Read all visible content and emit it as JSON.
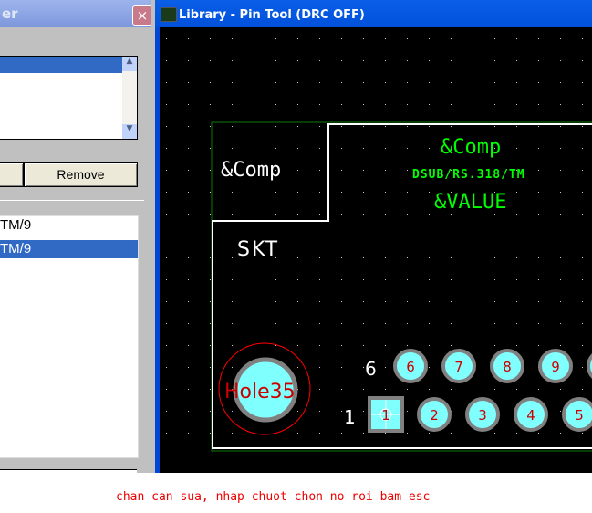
{
  "left_dialog": {
    "title_fragment": "er",
    "close": "×",
    "remove_label": "Remove",
    "list_items": [
      "TM/9",
      "TM/9"
    ]
  },
  "window": {
    "title": "Library - Pin Tool (DRC OFF)"
  },
  "canvas": {
    "comp_box": "&Comp",
    "comp_green": "&Comp",
    "package": "DSUB/RS.318/TM",
    "value": "&VALUE",
    "ref": "SKT",
    "hole": "Hole35",
    "row_top_label": "6",
    "row_bottom_label": "1",
    "pads_top": [
      "6",
      "7",
      "8",
      "9"
    ],
    "pads_bottom": [
      "1",
      "2",
      "3",
      "4",
      "5"
    ]
  },
  "note": "chan can sua, nhap chuot chon no roi bam esc"
}
